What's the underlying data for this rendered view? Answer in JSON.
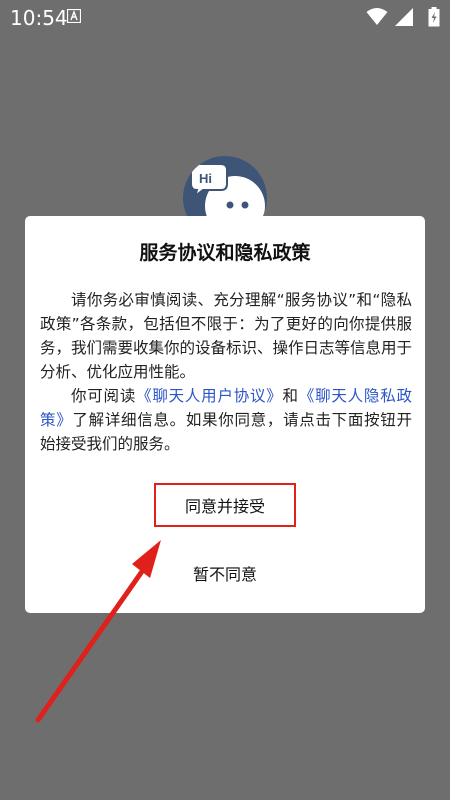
{
  "status_bar": {
    "time": "10:54",
    "notification_icon": "a-box-icon",
    "icons": [
      "wifi-icon",
      "signal-icon",
      "battery-charging-icon"
    ]
  },
  "app": {
    "logo_icon": "hi-chat-mascot-icon"
  },
  "dialog": {
    "title": "服务协议和隐私政策",
    "paragraph1": "请你务必审慎阅读、充分理解“服务协议”和“隐私政策”各条款，包括但不限于：为了更好的向你提供服务，我们需要收集你的设备标识、操作日志等信息用于分析、优化应用性能。",
    "paragraph2_prefix": "你可阅读",
    "user_agreement_link": "《聊天人用户协议》",
    "paragraph2_and": "和",
    "privacy_policy_link": "《聊天人隐私政策》",
    "paragraph2_suffix": "了解详细信息。如果你同意，请点击下面按钮开始接受我们的服务。",
    "agree_label": "同意并接受",
    "disagree_label": "暂不同意"
  },
  "colors": {
    "overlay": "#6e6e6e",
    "dialog_bg": "#ffffff",
    "link": "#2b55c8",
    "annotation": "#e0201a"
  }
}
